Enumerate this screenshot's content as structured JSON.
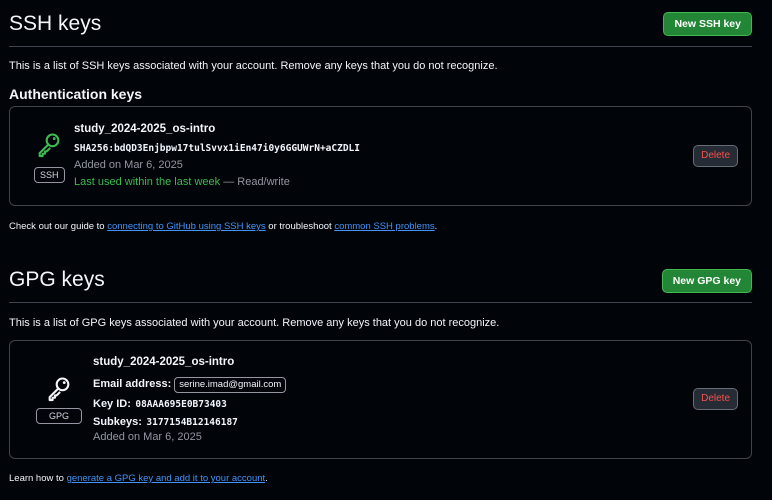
{
  "ssh": {
    "title": "SSH keys",
    "new_button": "New SSH key",
    "description": "This is a list of SSH keys associated with your account. Remove any keys that you do not recognize.",
    "subheading": "Authentication keys",
    "key": {
      "icon": "key-icon",
      "icon_color": "#3fb950",
      "badge": "SSH",
      "name": "study_2024-2025_os-intro",
      "fingerprint": "SHA256:bdQD3Enjbpw17tulSvvx1iEn47i0y6GGUWrN+aCZDLI",
      "added": "Added on Mar 6, 2025",
      "last_used": "Last used within the last week",
      "access": "— Read/write",
      "delete_label": "Delete"
    },
    "note": {
      "prefix": "Check out our guide to ",
      "link1": "connecting to GitHub using SSH keys",
      "middle": " or troubleshoot ",
      "link2": "common SSH problems",
      "suffix": "."
    }
  },
  "gpg": {
    "title": "GPG keys",
    "new_button": "New GPG key",
    "description": "This is a list of GPG keys associated with your account. Remove any keys that you do not recognize.",
    "key": {
      "icon": "key-icon",
      "badge": "GPG",
      "name": "study_2024-2025_os-intro",
      "email_label": "Email address:",
      "email": "serine.imad@gmail.com",
      "keyid_label": "Key ID:",
      "keyid": "08AAA695E0B73403",
      "subkeys_label": "Subkeys:",
      "subkeys": "3177154B12146187",
      "added": "Added on Mar 6, 2025",
      "delete_label": "Delete"
    },
    "note": {
      "prefix": "Learn how to ",
      "link": "generate a GPG key and add it to your account",
      "suffix": "."
    }
  }
}
